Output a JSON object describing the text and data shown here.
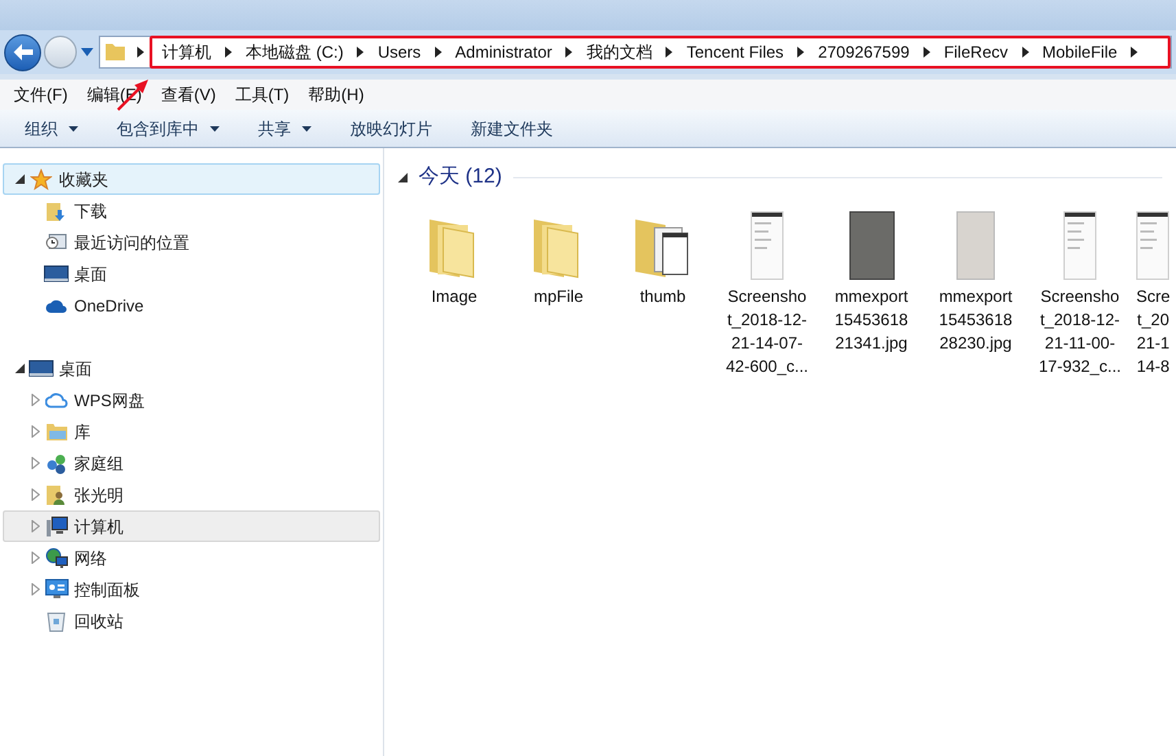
{
  "address_bar": {
    "breadcrumbs": [
      "计算机",
      "本地磁盘 (C:)",
      "Users",
      "Administrator",
      "我的文档",
      "Tencent Files",
      "2709267599",
      "FileRecv",
      "MobileFile"
    ]
  },
  "menu_bar": [
    "文件(F)",
    "编辑(E)",
    "查看(V)",
    "工具(T)",
    "帮助(H)"
  ],
  "toolbar": [
    {
      "label": "组织",
      "dropdown": true
    },
    {
      "label": "包含到库中",
      "dropdown": true
    },
    {
      "label": "共享",
      "dropdown": true
    },
    {
      "label": "放映幻灯片",
      "dropdown": false
    },
    {
      "label": "新建文件夹",
      "dropdown": false
    }
  ],
  "sidebar": {
    "groups": [
      {
        "label": "收藏夹",
        "kind": "favorites",
        "expanded": true,
        "selected": true,
        "hovered": false,
        "children": [
          {
            "label": "下载",
            "kind": "downloads",
            "selected": false,
            "hovered": false
          },
          {
            "label": "最近访问的位置",
            "kind": "recent",
            "selected": false,
            "hovered": false
          },
          {
            "label": "桌面",
            "kind": "desktop",
            "selected": false,
            "hovered": false
          },
          {
            "label": "OneDrive",
            "kind": "cloud",
            "selected": false,
            "hovered": false
          }
        ]
      },
      {
        "label": "桌面",
        "kind": "desktop",
        "expanded": true,
        "selected": false,
        "hovered": false,
        "children": [
          {
            "label": "WPS网盘",
            "kind": "cloud-outline",
            "expanded": false,
            "selected": false,
            "hovered": false
          },
          {
            "label": "库",
            "kind": "library",
            "expanded": false,
            "selected": false,
            "hovered": false
          },
          {
            "label": "家庭组",
            "kind": "homegroup",
            "expanded": false,
            "selected": false,
            "hovered": false
          },
          {
            "label": "张光明",
            "kind": "user",
            "expanded": false,
            "selected": false,
            "hovered": false
          },
          {
            "label": "计算机",
            "kind": "computer",
            "expanded": false,
            "selected": false,
            "hovered": true
          },
          {
            "label": "网络",
            "kind": "network",
            "expanded": false,
            "selected": false,
            "hovered": false
          },
          {
            "label": "控制面板",
            "kind": "controlpanel",
            "expanded": false,
            "selected": false,
            "hovered": false
          },
          {
            "label": "回收站",
            "kind": "recycle",
            "selected": false,
            "hovered": false
          }
        ]
      }
    ]
  },
  "content": {
    "group_header": "今天 (12)",
    "expanded": true,
    "files": [
      {
        "kind": "folder",
        "lines": [
          "Image"
        ]
      },
      {
        "kind": "folder",
        "lines": [
          "mpFile"
        ]
      },
      {
        "kind": "folder-with-docs",
        "lines": [
          "thumb"
        ]
      },
      {
        "kind": "screenshot",
        "lines": [
          "Screensho",
          "t_2018-12-",
          "21-14-07-",
          "42-600_c..."
        ]
      },
      {
        "kind": "dark-photo",
        "lines": [
          "mmexport",
          "15453618",
          "21341.jpg"
        ]
      },
      {
        "kind": "paper-photo",
        "lines": [
          "mmexport",
          "15453618",
          "28230.jpg"
        ]
      },
      {
        "kind": "screenshot",
        "lines": [
          "Screensho",
          "t_2018-12-",
          "21-11-00-",
          "17-932_c..."
        ]
      },
      {
        "kind": "screenshot",
        "lines": [
          "Scre",
          "t_20",
          "21-1",
          "14-8"
        ]
      }
    ]
  }
}
